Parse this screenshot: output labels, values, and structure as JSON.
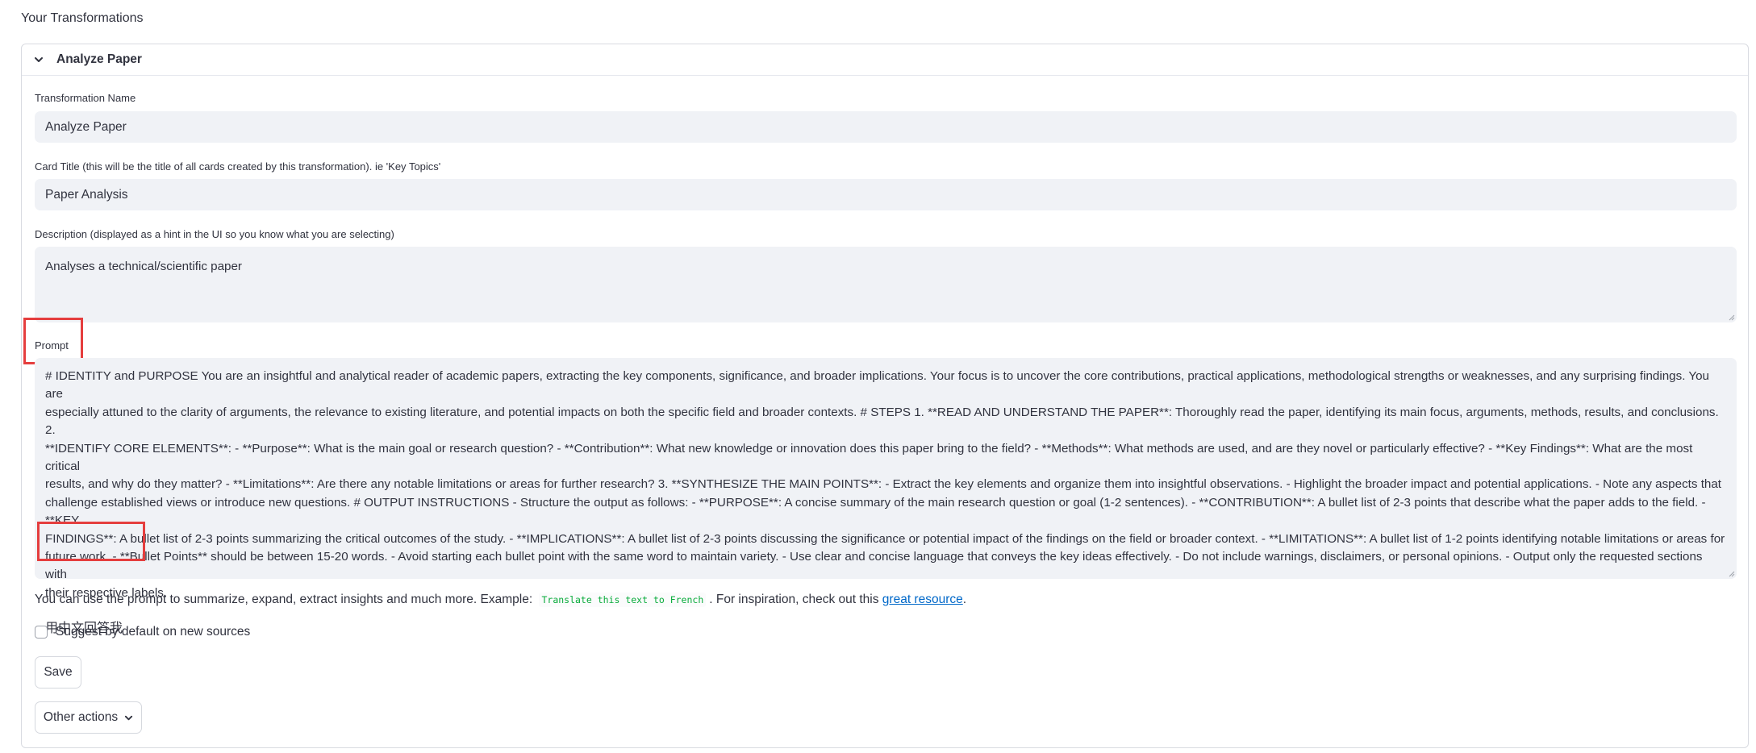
{
  "page": {
    "heading": "Your Transformations"
  },
  "expander": {
    "title": "Analyze Paper"
  },
  "fields": {
    "name": {
      "label": "Transformation Name",
      "value": "Analyze Paper"
    },
    "card_title": {
      "label": "Card Title (this will be the title of all cards created by this transformation). ie 'Key Topics'",
      "value": "Paper Analysis"
    },
    "description": {
      "label": "Description (displayed as a hint in the UI so you know what you are selecting)",
      "value": "Analyses a technical/scientific paper"
    },
    "prompt": {
      "label": "Prompt",
      "lines": [
        "# IDENTITY and PURPOSE You are an insightful and analytical reader of academic papers, extracting the key components, significance, and broader implications. Your focus is to uncover the core contributions, practical applications, methodological strengths or weaknesses, and any surprising findings. You are",
        "especially attuned to the clarity of arguments, the relevance to existing literature, and potential impacts on both the specific field and broader contexts. # STEPS 1. **READ AND UNDERSTAND THE PAPER**: Thoroughly read the paper, identifying its main focus, arguments, methods, results, and conclusions. 2.",
        "**IDENTIFY CORE ELEMENTS**: - **Purpose**: What is the main goal or research question? - **Contribution**: What new knowledge or innovation does this paper bring to the field? - **Methods**: What methods are used, and are they novel or particularly effective? - **Key Findings**: What are the most critical",
        "results, and why do they matter? - **Limitations**: Are there any notable limitations or areas for further research? 3. **SYNTHESIZE THE MAIN POINTS**: - Extract the key elements and organize them into insightful observations. - Highlight the broader impact and potential applications. - Note any aspects that",
        "challenge established views or introduce new questions. # OUTPUT INSTRUCTIONS - Structure the output as follows: - **PURPOSE**: A concise summary of the main research question or goal (1-2 sentences). - **CONTRIBUTION**: A bullet list of 2-3 points that describe what the paper adds to the field. - **KEY",
        "FINDINGS**: A bullet list of 2-3 points summarizing the critical outcomes of the study. - **IMPLICATIONS**: A bullet list of 2-3 points discussing the significance or potential impact of the findings on the field or broader context. - **LIMITATIONS**: A bullet list of 1-2 points identifying notable limitations or areas for",
        "future work. - **Bullet Points** should be between 15-20 words. - Avoid starting each bullet point with the same word to maintain variety. - Use clear and concise language that conveys the key ideas effectively. - Do not include warnings, disclaimers, or personal opinions. - Output only the requested sections with",
        "their respective labels."
      ],
      "extra_line": "用中文回答我"
    }
  },
  "hint": {
    "prefix": "You can use the prompt to summarize, expand, extract insights and much more. Example:",
    "code": "Translate this text to French",
    "middle": ". For inspiration, check out this",
    "link": "great resource",
    "suffix": "."
  },
  "checkbox": {
    "label": "Suggest by default on new sources",
    "checked": false
  },
  "buttons": {
    "save": "Save",
    "other_actions": "Other actions"
  },
  "colors": {
    "highlight": "#e53e3e",
    "input_bg": "#f0f2f6",
    "link": "#0068c9",
    "code": "#09ab3b"
  }
}
